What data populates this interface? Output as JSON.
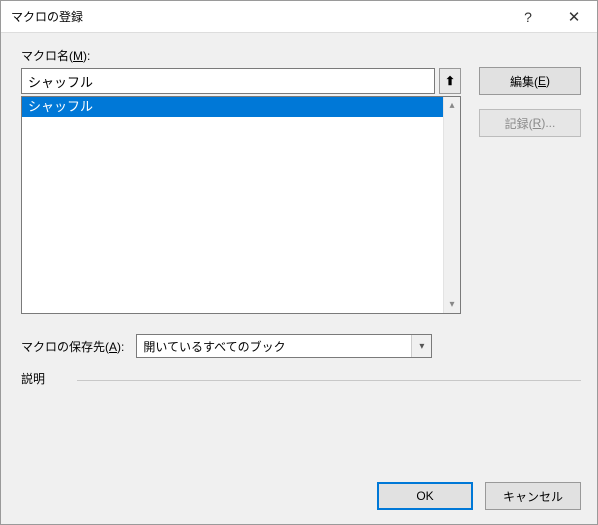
{
  "window": {
    "title": "マクロの登録",
    "help": "?",
    "close": "✕"
  },
  "labels": {
    "macro_name_prefix": "マクロ名(",
    "macro_name_key": "M",
    "macro_name_suffix": "):",
    "save_in_prefix": "マクロの保存先(",
    "save_in_key": "A",
    "save_in_suffix": "):",
    "description": "説明"
  },
  "macro_name_value": "シャッフル",
  "macro_list": [
    {
      "label": "シャッフル",
      "selected": true
    }
  ],
  "save_in_selected": "開いているすべてのブック",
  "buttons": {
    "edit_prefix": "編集(",
    "edit_key": "E",
    "edit_suffix": ")",
    "record_prefix": "記録(",
    "record_key": "R",
    "record_suffix": ")...",
    "ok": "OK",
    "cancel": "キャンセル"
  },
  "icons": {
    "assign_arrow": "⬆",
    "scroll_up": "▴",
    "scroll_down": "▾",
    "dropdown": "▾"
  }
}
